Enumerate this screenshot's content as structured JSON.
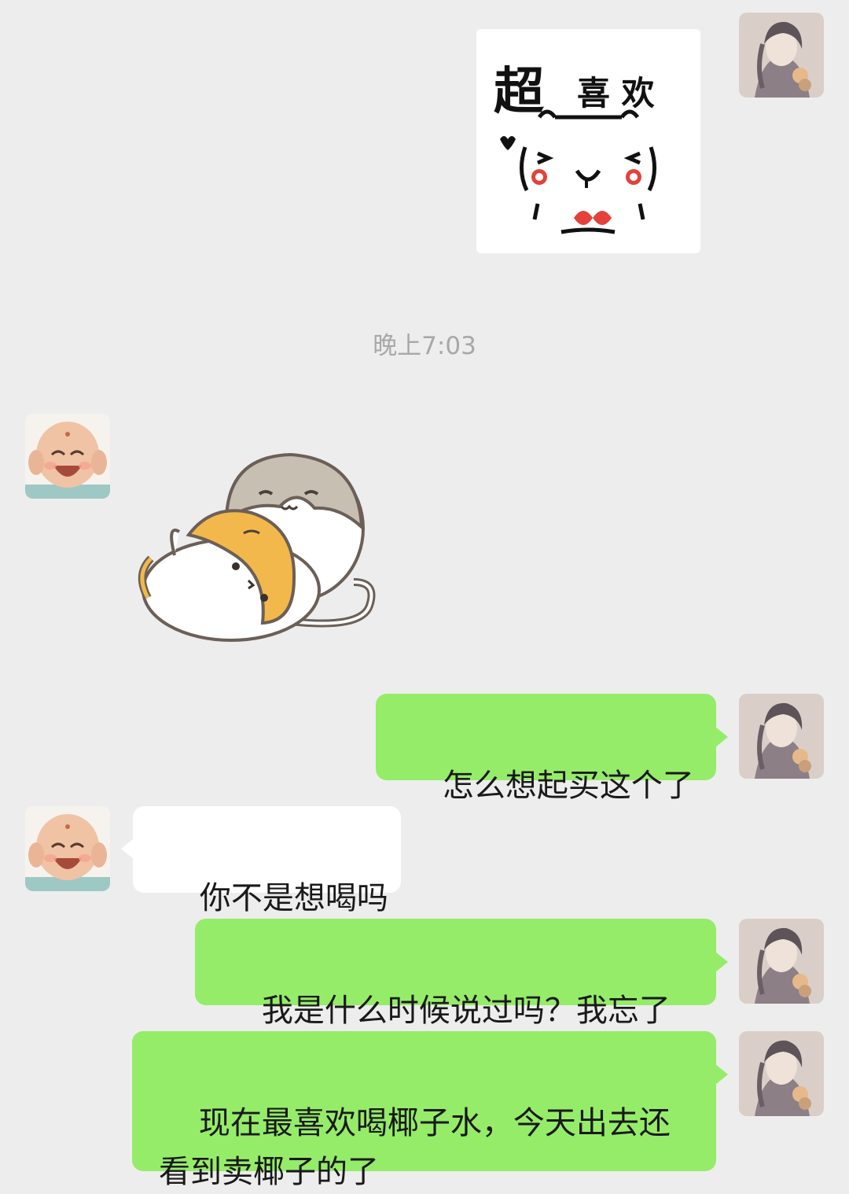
{
  "stickers": {
    "love_sticker_caption": {
      "big": "超",
      "rest": "喜 欢"
    }
  },
  "timestamp": "晚上7:03",
  "messages": [
    {
      "sender": "me",
      "text": "怎么想起买这个了"
    },
    {
      "sender": "them",
      "text": "你不是想喝吗"
    },
    {
      "sender": "me",
      "text": "我是什么时候说过吗？我忘了"
    },
    {
      "sender": "me",
      "text": "现在最喜欢喝椰子水，今天出去还\n看到卖椰子的了"
    }
  ],
  "colors": {
    "background": "#ededed",
    "my_bubble": "#95ec69",
    "their_bubble": "#ffffff",
    "timestamp_text": "#a8a8a8"
  }
}
